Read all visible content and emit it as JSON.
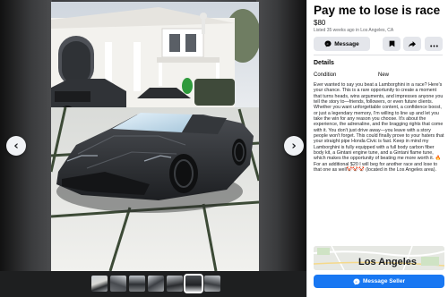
{
  "listing": {
    "title": "Pay me to lose is race",
    "price": "$80",
    "listed": "Listed 35 weeks ago in Los Angeles, CA",
    "message_label": "Message",
    "details_heading": "Details",
    "condition_label": "Condition",
    "condition_value": "New",
    "description": "Ever wanted to say you beat a Lamborghini in a race? Here's your chance. This is a rare opportunity to create a moment that turns heads, wins arguments, and impresses anyone you tell the story to—friends, followers, or even future clients. Whether you want unforgettable content, a confidence boost, or just a legendary memory, I'm willing to line up and let you take the win for any reason you choose. It's about the experience, the adrenaline, and the bragging rights that come with it. You don't just drive away—you leave with a story people won't forget. This could finally prove to your haters that your straight pipe Honda Civic is fast. Keep in mind my Lamborghini is fully equipped with a full body carbon fiber body kit, a Gintani engine tune, and a Gintani flame tune, which makes the opportunity of beating me more worth it. 🔥For an additional $20 I will beg for another race and lose to that one as well🤡🤡🤡 (located in the Los Angeles area).",
    "map_label": "Los Angeles",
    "seller_button": "Message Seller"
  },
  "icons": {
    "prev": "chevron-left-icon",
    "next": "chevron-right-icon",
    "message": "messenger-icon",
    "save": "bookmark-icon",
    "share": "share-icon",
    "more": "more-icon"
  },
  "colors": {
    "accent": "#1877f2",
    "button_bg": "#e4e6eb",
    "muted_text": "#65676b"
  }
}
